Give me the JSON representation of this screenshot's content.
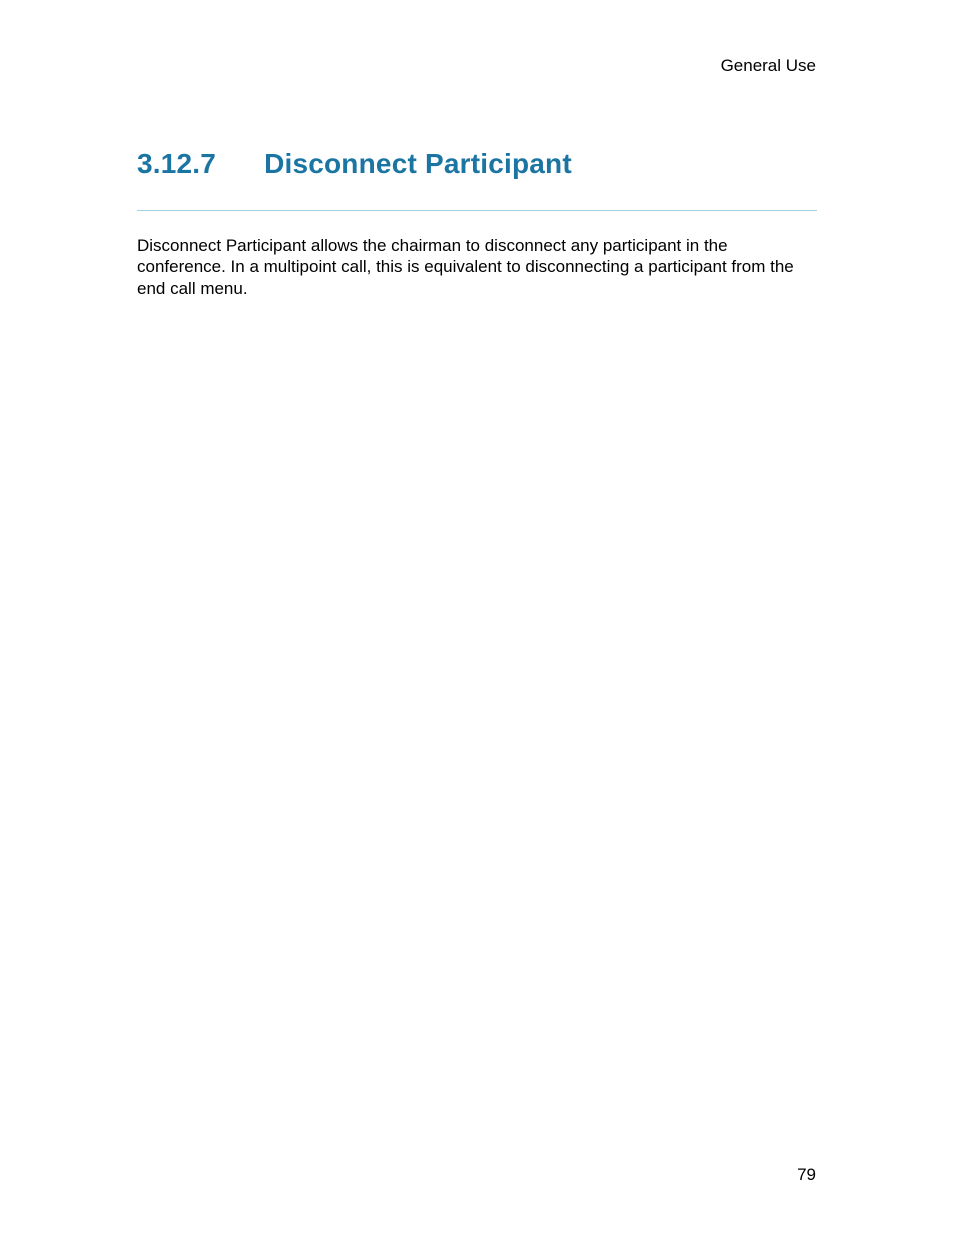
{
  "header": {
    "section_label": "General Use"
  },
  "heading": {
    "number": "3.12.7",
    "title": "Disconnect Participant"
  },
  "body": {
    "paragraph": "Disconnect Participant allows the chairman to disconnect any participant in the conference. In a multipoint call, this is equivalent to disconnecting a participant from the end call menu."
  },
  "footer": {
    "page_number": "79"
  }
}
